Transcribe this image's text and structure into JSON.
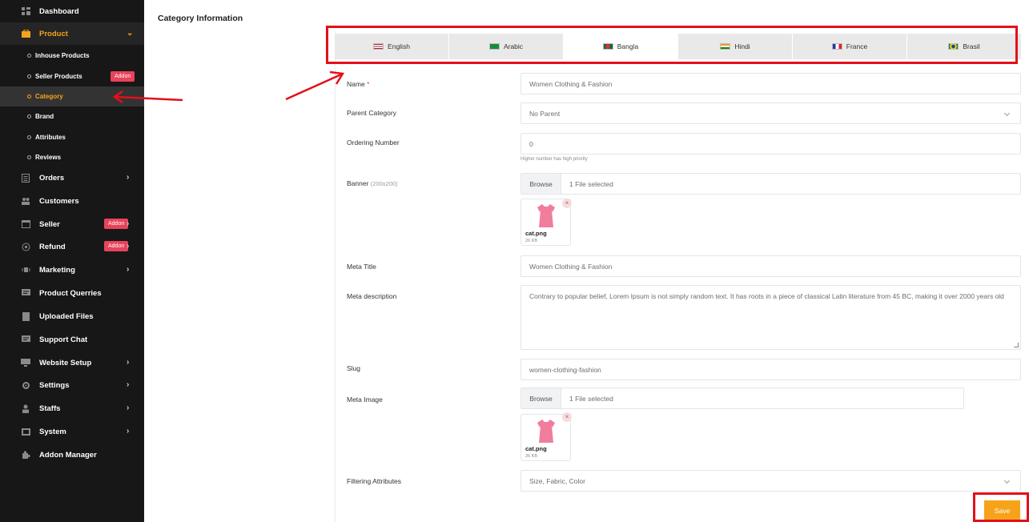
{
  "sidebar": {
    "items": [
      {
        "label": "Dashboard",
        "icon": "dashboard-icon"
      },
      {
        "label": "Product",
        "icon": "product-icon",
        "active": true
      },
      {
        "label": "Orders",
        "icon": "orders-icon"
      },
      {
        "label": "Customers",
        "icon": "customers-icon"
      },
      {
        "label": "Seller",
        "icon": "seller-icon",
        "badge": "Addon"
      },
      {
        "label": "Refund",
        "icon": "refund-icon",
        "badge": "Addon"
      },
      {
        "label": "Marketing",
        "icon": "marketing-icon"
      },
      {
        "label": "Product Querries",
        "icon": "chat-icon"
      },
      {
        "label": "Uploaded Files",
        "icon": "file-icon"
      },
      {
        "label": "Support Chat",
        "icon": "support-chat-icon"
      },
      {
        "label": "Website Setup",
        "icon": "monitor-icon"
      },
      {
        "label": "Settings",
        "icon": "gear-icon"
      },
      {
        "label": "Staffs",
        "icon": "user-icon"
      },
      {
        "label": "System",
        "icon": "system-icon"
      },
      {
        "label": "Addon Manager",
        "icon": "puzzle-icon"
      }
    ],
    "product_subitems": [
      {
        "label": "Inhouse Products"
      },
      {
        "label": "Seller Products",
        "badge": "Addon"
      },
      {
        "label": "Category",
        "active": true
      },
      {
        "label": "Brand"
      },
      {
        "label": "Attributes"
      },
      {
        "label": "Reviews"
      }
    ],
    "accent_color": "#f6a31a",
    "badge_color": "#e8435a"
  },
  "main": {
    "title": "Category Information",
    "language_tabs": [
      {
        "label": "English",
        "flag": "us-flag-icon"
      },
      {
        "label": "Arabic",
        "flag": "sa-flag-icon"
      },
      {
        "label": "Bangla",
        "flag": "bd-flag-icon",
        "active": true
      },
      {
        "label": "Hindi",
        "flag": "in-flag-icon"
      },
      {
        "label": "France",
        "flag": "fr-flag-icon"
      },
      {
        "label": "Brasil",
        "flag": "br-flag-icon"
      }
    ],
    "form": {
      "name_label": "Name",
      "name_required": "*",
      "name_value": "Women Clothing & Fashion",
      "parent_label": "Parent Category",
      "parent_value": "No Parent",
      "ordering_label": "Ordering Number",
      "ordering_value": "0",
      "ordering_hint": "Higher number has high priority",
      "banner_label": "Banner",
      "banner_size": "(200x200)",
      "banner_browse": "Browse",
      "banner_count": "1 File selected",
      "banner_file_name": "cat.png",
      "banner_file_size": "26 KB",
      "meta_title_label": "Meta Title",
      "meta_title_value": "Women Clothing & Fashion",
      "meta_desc_label": "Meta description",
      "meta_desc_value": "Contrary to popular belief, Lorem Ipsum is not simply random text. It has roots in a piece of classical Latin literature from 45 BC, making it over 2000 years old",
      "slug_label": "Slug",
      "slug_value": "women-clothing-fashion",
      "meta_image_label": "Meta Image",
      "meta_image_browse": "Browse",
      "meta_image_count": "1 File selected",
      "meta_image_file_name": "cat.png",
      "meta_image_file_size": "26 KB",
      "filter_label": "Filtering Attributes",
      "filter_value": "Size, Fabric, Color",
      "save_label": "Save"
    }
  },
  "annotation_color": "#e3101a"
}
